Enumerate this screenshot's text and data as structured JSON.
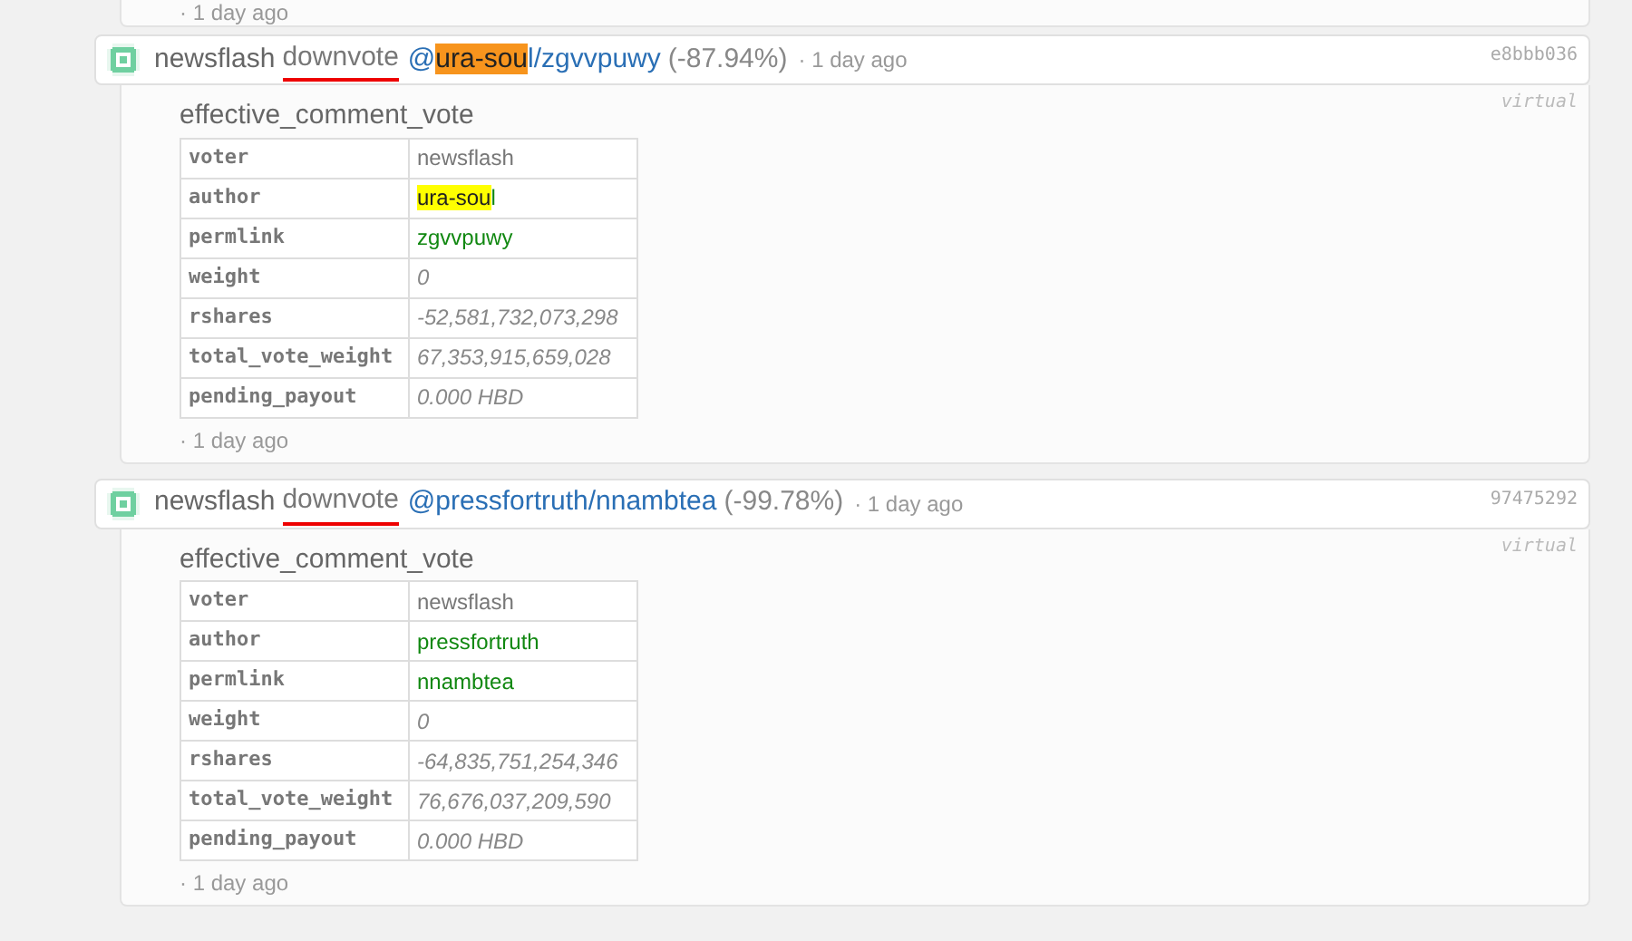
{
  "top_fragment": {
    "time": "· 1 day ago"
  },
  "operations": [
    {
      "voter": "newsflash",
      "action": "downvote",
      "action_underlined": true,
      "target": [
        {
          "text": "@"
        },
        {
          "text": "ura-sou",
          "highlighted": true
        },
        {
          "text": "l/zgvvpuwy"
        }
      ],
      "percent": "(-87.94%)",
      "time": "· 1 day ago",
      "hash": "e8bbb036",
      "tag": "virtual",
      "op_name": "effective_comment_vote",
      "rows": [
        {
          "key": "voter",
          "kind": "plain",
          "value": [
            {
              "text": "newsflash"
            }
          ]
        },
        {
          "key": "author",
          "kind": "account",
          "value": [
            {
              "text": "ura-sou",
              "highlighted": true
            },
            {
              "text": "l"
            }
          ]
        },
        {
          "key": "permlink",
          "kind": "account",
          "value": [
            {
              "text": "zgvvpuwy"
            }
          ]
        },
        {
          "key": "weight",
          "kind": "number",
          "value": [
            {
              "text": "0"
            }
          ]
        },
        {
          "key": "rshares",
          "kind": "number",
          "value": [
            {
              "text": "-52,581,732,073,298"
            }
          ]
        },
        {
          "key": "total_vote_weight",
          "kind": "number",
          "value": [
            {
              "text": "67,353,915,659,028"
            }
          ]
        },
        {
          "key": "pending_payout",
          "kind": "number",
          "value": [
            {
              "text": "0.000 HBD"
            }
          ]
        }
      ],
      "footer_time": "· 1 day ago"
    },
    {
      "voter": "newsflash",
      "action": "downvote",
      "action_underlined": true,
      "target": [
        {
          "text": "@pressfortruth/nnambtea"
        }
      ],
      "percent": "(-99.78%)",
      "time": "· 1 day ago",
      "hash": "97475292",
      "tag": "virtual",
      "op_name": "effective_comment_vote",
      "rows": [
        {
          "key": "voter",
          "kind": "plain",
          "value": [
            {
              "text": "newsflash"
            }
          ]
        },
        {
          "key": "author",
          "kind": "account",
          "value": [
            {
              "text": "pressfortruth"
            }
          ]
        },
        {
          "key": "permlink",
          "kind": "account",
          "value": [
            {
              "text": "nnambtea"
            }
          ]
        },
        {
          "key": "weight",
          "kind": "number",
          "value": [
            {
              "text": "0"
            }
          ]
        },
        {
          "key": "rshares",
          "kind": "number",
          "value": [
            {
              "text": "-64,835,751,254,346"
            }
          ]
        },
        {
          "key": "total_vote_weight",
          "kind": "number",
          "value": [
            {
              "text": "76,676,037,209,590"
            }
          ]
        },
        {
          "key": "pending_payout",
          "kind": "number",
          "value": [
            {
              "text": "0.000 HBD"
            }
          ]
        }
      ],
      "footer_time": "· 1 day ago"
    }
  ]
}
